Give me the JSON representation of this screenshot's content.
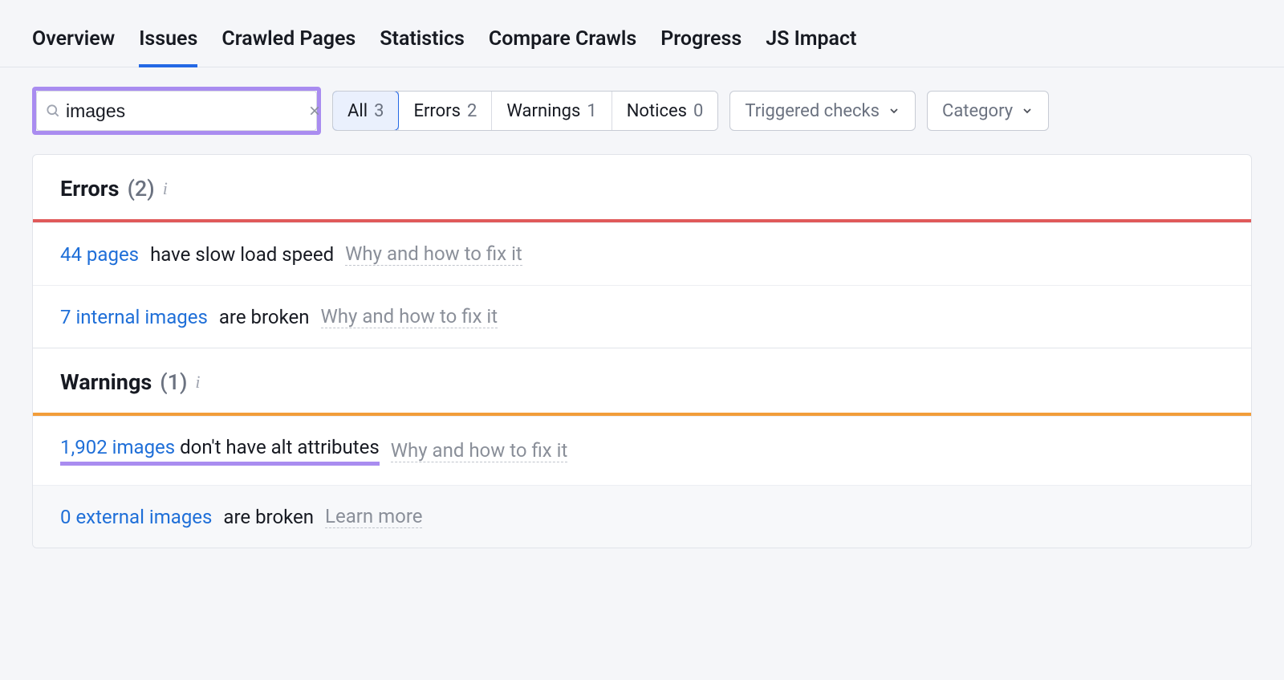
{
  "tabs": {
    "overview": "Overview",
    "issues": "Issues",
    "crawled_pages": "Crawled Pages",
    "statistics": "Statistics",
    "compare": "Compare Crawls",
    "progress": "Progress",
    "js_impact": "JS Impact",
    "active": "issues"
  },
  "search": {
    "value": "images"
  },
  "filters": {
    "all": {
      "label": "All",
      "count": "3"
    },
    "errors": {
      "label": "Errors",
      "count": "2"
    },
    "warnings": {
      "label": "Warnings",
      "count": "1"
    },
    "notices": {
      "label": "Notices",
      "count": "0"
    },
    "triggered": "Triggered checks",
    "category": "Category"
  },
  "sections": {
    "errors": {
      "title": "Errors",
      "count": "(2)",
      "items": [
        {
          "link": "44 pages",
          "rest": "have slow load speed",
          "hint": "Why and how to fix it"
        },
        {
          "link": "7 internal images",
          "rest": "are broken",
          "hint": "Why and how to fix it"
        }
      ]
    },
    "warnings": {
      "title": "Warnings",
      "count": "(1)",
      "items": [
        {
          "link": "1,902 images",
          "rest": "don't have alt attributes",
          "hint": "Why and how to fix it",
          "highlight": true
        },
        {
          "link": "0 external images",
          "rest": "are broken",
          "hint": "Learn more",
          "dim": true
        }
      ]
    }
  }
}
